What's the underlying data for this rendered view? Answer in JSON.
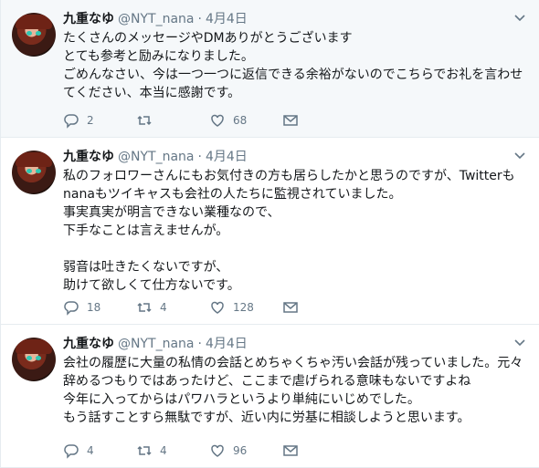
{
  "tweets": [
    {
      "name": "九重なゆ",
      "handle": "@NYT_nana",
      "dot": "·",
      "date": "4月4日",
      "text": "たくさんのメッセージやDMありがとうございます\nとても参考と励みになりました。\nごめんなさい、今は一つ一つに返信できる余裕がないのでこちらでお礼を言わせてください、本当に感謝です。",
      "replies": "2",
      "retweets": "",
      "likes": "68"
    },
    {
      "name": "九重なゆ",
      "handle": "@NYT_nana",
      "dot": "·",
      "date": "4月4日",
      "text": "私のフォロワーさんにもお気付きの方も居らしたかと思うのですが、Twitterもnanaもツイキャスも会社の人たちに監視されていました。\n事実真実が明言できない業種なので、\n下手なことは言えませんが。\n\n弱音は吐きたくないですが、\n助けて欲しくて仕方ないです。",
      "replies": "18",
      "retweets": "4",
      "likes": "128"
    },
    {
      "name": "九重なゆ",
      "handle": "@NYT_nana",
      "dot": "·",
      "date": "4月4日",
      "text": "会社の履歴に大量の私情の会話とめちゃくちゃ汚い会話が残っていました。元々辞めるつもりではあったけど、ここまで虐げられる意味もないですよね\n今年に入ってからはパワハラというより単純にいじめでした。\nもう話すことすら無駄ですが、近い内に労基に相談しようと思います。",
      "replies": "4",
      "retweets": "4",
      "likes": "96"
    }
  ],
  "colors": {
    "text": "#14171a",
    "muted": "#657786",
    "border": "#e6ecf0",
    "highlight_bg": "#f5f8fa"
  },
  "icons": [
    "reply-icon",
    "retweet-icon",
    "like-icon",
    "dm-icon",
    "chevron-down-icon"
  ]
}
